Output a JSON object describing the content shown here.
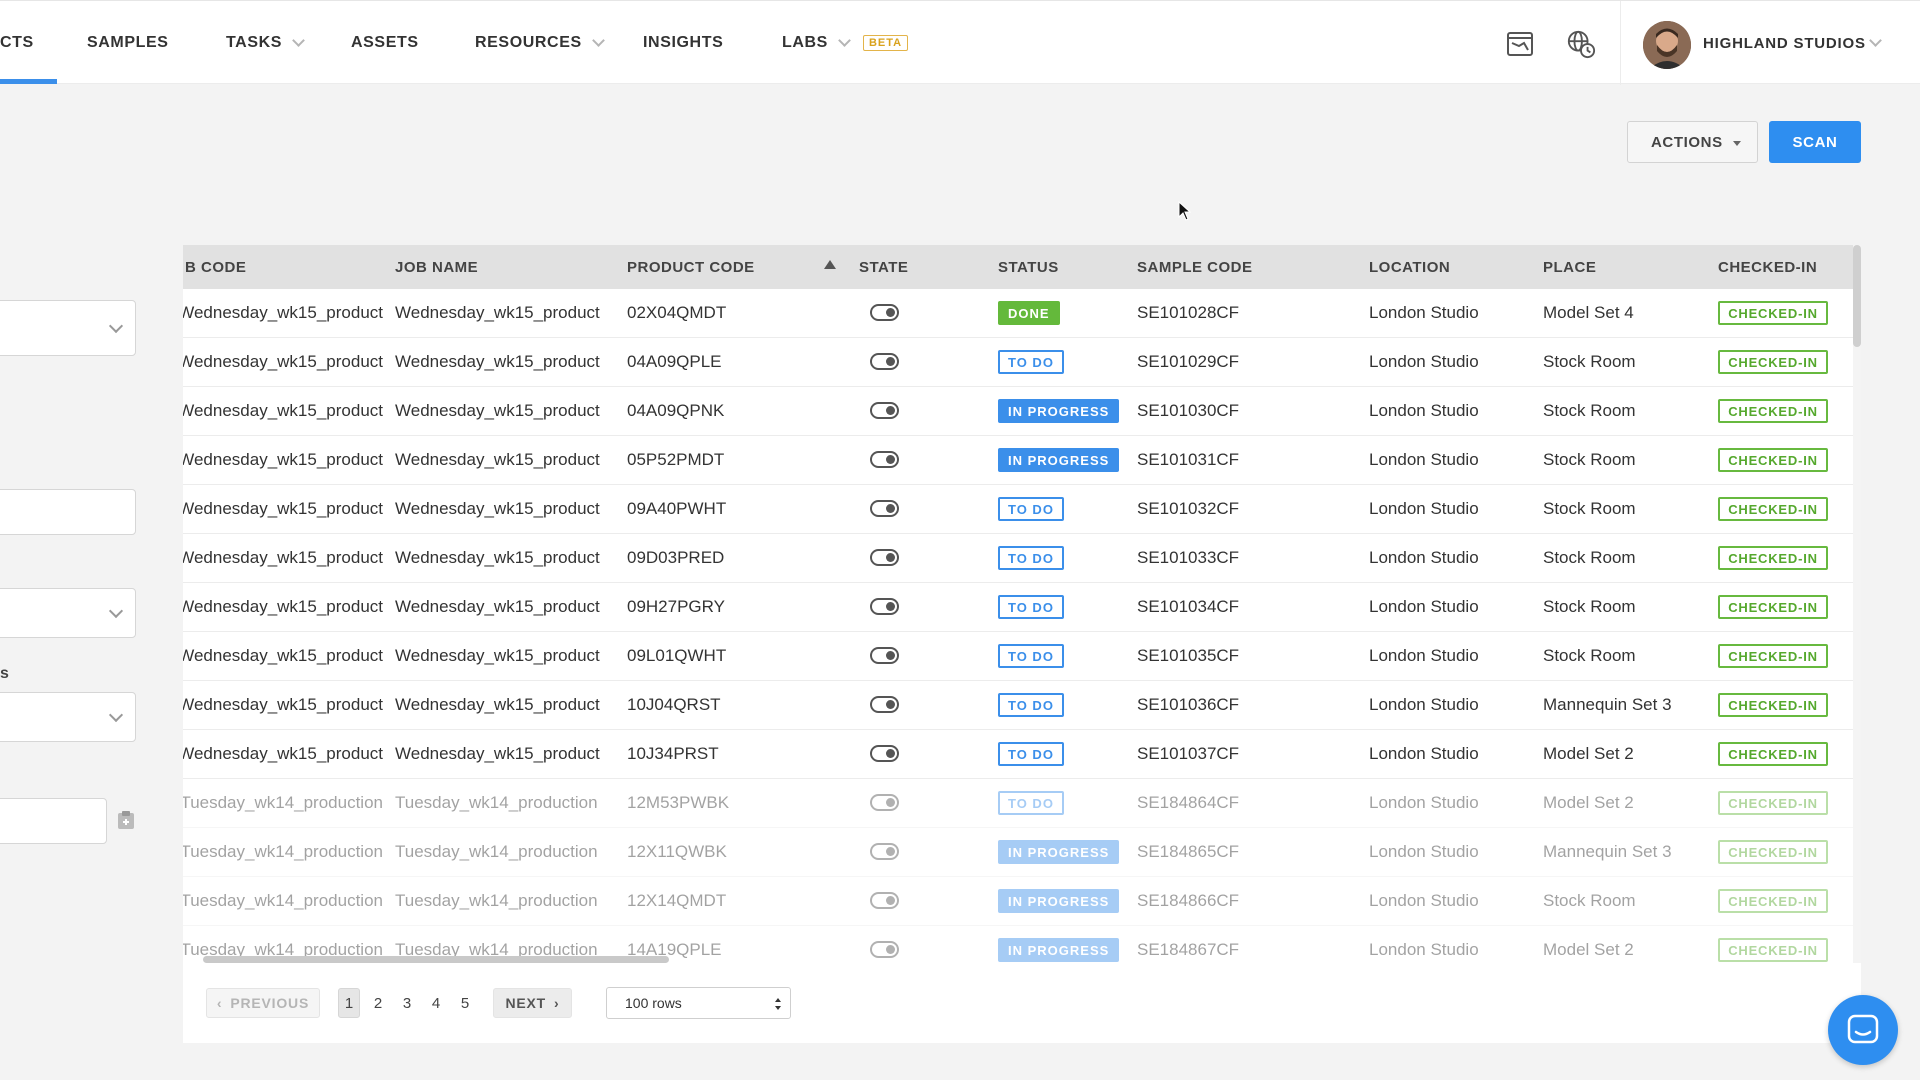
{
  "nav": {
    "items": [
      {
        "label": "CTS",
        "has_chevron": false,
        "active": true
      },
      {
        "label": "SAMPLES",
        "has_chevron": false
      },
      {
        "label": "TASKS",
        "has_chevron": true
      },
      {
        "label": "ASSETS",
        "has_chevron": false
      },
      {
        "label": "RESOURCES",
        "has_chevron": true
      },
      {
        "label": "INSIGHTS",
        "has_chevron": false
      },
      {
        "label": "LABS",
        "has_chevron": true
      }
    ],
    "beta_badge": "BETA",
    "icons": [
      "chart-window-icon",
      "globe-clock-icon"
    ],
    "user": {
      "name": "HIGHLAND STUDIOS",
      "avatar_icon": "user-avatar"
    }
  },
  "toolbar": {
    "actions_label": "ACTIONS",
    "scan_label": "SCAN"
  },
  "filters": {
    "partial_label": "s"
  },
  "table": {
    "columns": [
      "B CODE",
      "JOB NAME",
      "PRODUCT CODE",
      "STATE",
      "STATUS",
      "SAMPLE CODE",
      "LOCATION",
      "PLACE",
      "CHECKED-IN"
    ],
    "sorted_column": "PRODUCT CODE",
    "rows": [
      {
        "job_code": "Wednesday_wk15_product",
        "job_name": "Wednesday_wk15_product",
        "product_code": "02X04QMDT",
        "status": "DONE",
        "status_type": "done",
        "sample_code": "SE101028CF",
        "location": "London Studio",
        "place": "Model Set 4",
        "checked_in": "CHECKED-IN",
        "dim": false
      },
      {
        "job_code": "Wednesday_wk15_product",
        "job_name": "Wednesday_wk15_product",
        "product_code": "04A09QPLE",
        "status": "TO DO",
        "status_type": "todo",
        "sample_code": "SE101029CF",
        "location": "London Studio",
        "place": "Stock Room",
        "checked_in": "CHECKED-IN",
        "dim": false
      },
      {
        "job_code": "Wednesday_wk15_product",
        "job_name": "Wednesday_wk15_product",
        "product_code": "04A09QPNK",
        "status": "IN PROGRESS",
        "status_type": "inprogress",
        "sample_code": "SE101030CF",
        "location": "London Studio",
        "place": "Stock Room",
        "checked_in": "CHECKED-IN",
        "dim": false
      },
      {
        "job_code": "Wednesday_wk15_product",
        "job_name": "Wednesday_wk15_product",
        "product_code": "05P52PMDT",
        "status": "IN PROGRESS",
        "status_type": "inprogress",
        "sample_code": "SE101031CF",
        "location": "London Studio",
        "place": "Stock Room",
        "checked_in": "CHECKED-IN",
        "dim": false
      },
      {
        "job_code": "Wednesday_wk15_product",
        "job_name": "Wednesday_wk15_product",
        "product_code": "09A40PWHT",
        "status": "TO DO",
        "status_type": "todo",
        "sample_code": "SE101032CF",
        "location": "London Studio",
        "place": "Stock Room",
        "checked_in": "CHECKED-IN",
        "dim": false
      },
      {
        "job_code": "Wednesday_wk15_product",
        "job_name": "Wednesday_wk15_product",
        "product_code": "09D03PRED",
        "status": "TO DO",
        "status_type": "todo",
        "sample_code": "SE101033CF",
        "location": "London Studio",
        "place": "Stock Room",
        "checked_in": "CHECKED-IN",
        "dim": false
      },
      {
        "job_code": "Wednesday_wk15_product",
        "job_name": "Wednesday_wk15_product",
        "product_code": "09H27PGRY",
        "status": "TO DO",
        "status_type": "todo",
        "sample_code": "SE101034CF",
        "location": "London Studio",
        "place": "Stock Room",
        "checked_in": "CHECKED-IN",
        "dim": false
      },
      {
        "job_code": "Wednesday_wk15_product",
        "job_name": "Wednesday_wk15_product",
        "product_code": "09L01QWHT",
        "status": "TO DO",
        "status_type": "todo",
        "sample_code": "SE101035CF",
        "location": "London Studio",
        "place": "Stock Room",
        "checked_in": "CHECKED-IN",
        "dim": false
      },
      {
        "job_code": "Wednesday_wk15_product",
        "job_name": "Wednesday_wk15_product",
        "product_code": "10J04QRST",
        "status": "TO DO",
        "status_type": "todo",
        "sample_code": "SE101036CF",
        "location": "London Studio",
        "place": "Mannequin Set 3",
        "checked_in": "CHECKED-IN",
        "dim": false
      },
      {
        "job_code": "Wednesday_wk15_product",
        "job_name": "Wednesday_wk15_product",
        "product_code": "10J34PRST",
        "status": "TO DO",
        "status_type": "todo",
        "sample_code": "SE101037CF",
        "location": "London Studio",
        "place": "Model Set 2",
        "checked_in": "CHECKED-IN",
        "dim": false
      },
      {
        "job_code": "Tuesday_wk14_production",
        "job_name": "Tuesday_wk14_production",
        "product_code": "12M53PWBK",
        "status": "TO DO",
        "status_type": "todo",
        "sample_code": "SE184864CF",
        "location": "London Studio",
        "place": "Model Set 2",
        "checked_in": "CHECKED-IN",
        "dim": true
      },
      {
        "job_code": "Tuesday_wk14_production",
        "job_name": "Tuesday_wk14_production",
        "product_code": "12X11QWBK",
        "status": "IN PROGRESS",
        "status_type": "inprogress",
        "sample_code": "SE184865CF",
        "location": "London Studio",
        "place": "Mannequin Set 3",
        "checked_in": "CHECKED-IN",
        "dim": true
      },
      {
        "job_code": "Tuesday_wk14_production",
        "job_name": "Tuesday_wk14_production",
        "product_code": "12X14QMDT",
        "status": "IN PROGRESS",
        "status_type": "inprogress",
        "sample_code": "SE184866CF",
        "location": "London Studio",
        "place": "Stock Room",
        "checked_in": "CHECKED-IN",
        "dim": true
      },
      {
        "job_code": "Tuesday_wk14_production",
        "job_name": "Tuesday_wk14_production",
        "product_code": "14A19QPLE",
        "status": "IN PROGRESS",
        "status_type": "inprogress",
        "sample_code": "SE184867CF",
        "location": "London Studio",
        "place": "Model Set 2",
        "checked_in": "CHECKED-IN",
        "dim": true
      }
    ]
  },
  "pagination": {
    "previous_label": "PREVIOUS",
    "next_label": "NEXT",
    "pages": [
      "1",
      "2",
      "3",
      "4",
      "5"
    ],
    "current_page": "1",
    "rows_per_page": "100 rows"
  },
  "colors": {
    "accent": "#2e8ef0",
    "done": "#64b93b",
    "checked": "#67b93f",
    "beta": "#d9a21d"
  }
}
